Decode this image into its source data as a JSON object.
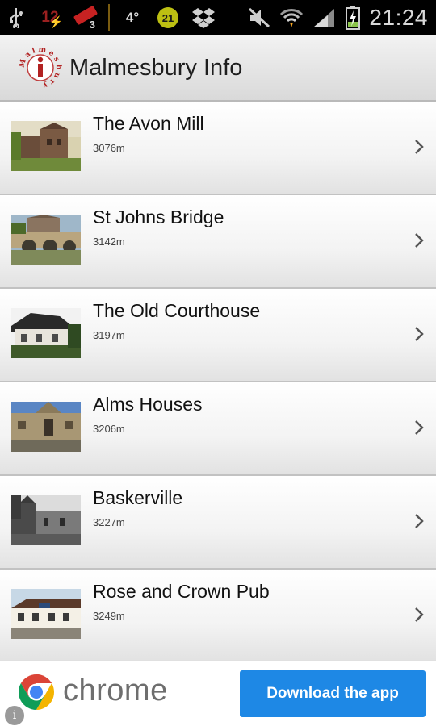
{
  "status_bar": {
    "notif_count_a": "12",
    "notif_count_b": "3",
    "temperature": "4°",
    "badge_count": "21",
    "time": "21:24",
    "icons": [
      "usb-icon",
      "notification-icon",
      "tag-icon",
      "weather-icon",
      "badge-icon",
      "dropbox-icon",
      "mute-icon",
      "wifi-icon",
      "signal-icon",
      "battery-charging-icon"
    ]
  },
  "header": {
    "title": "Malmesbury Info",
    "logo_icon": "info-logo-icon",
    "logo_text": "MalmesburyI",
    "accent_color": "#b22222"
  },
  "places": [
    {
      "name": "The Avon Mill",
      "distance": "3076m"
    },
    {
      "name": "St Johns Bridge",
      "distance": "3142m"
    },
    {
      "name": "The Old Courthouse",
      "distance": "3197m"
    },
    {
      "name": "Alms Houses",
      "distance": "3206m"
    },
    {
      "name": "Baskerville",
      "distance": "3227m"
    },
    {
      "name": "Rose and Crown Pub",
      "distance": "3249m"
    }
  ],
  "ad": {
    "brand": "chrome",
    "button_label": "Download the app",
    "button_color": "#1e88e5",
    "info_icon": "info-icon"
  }
}
